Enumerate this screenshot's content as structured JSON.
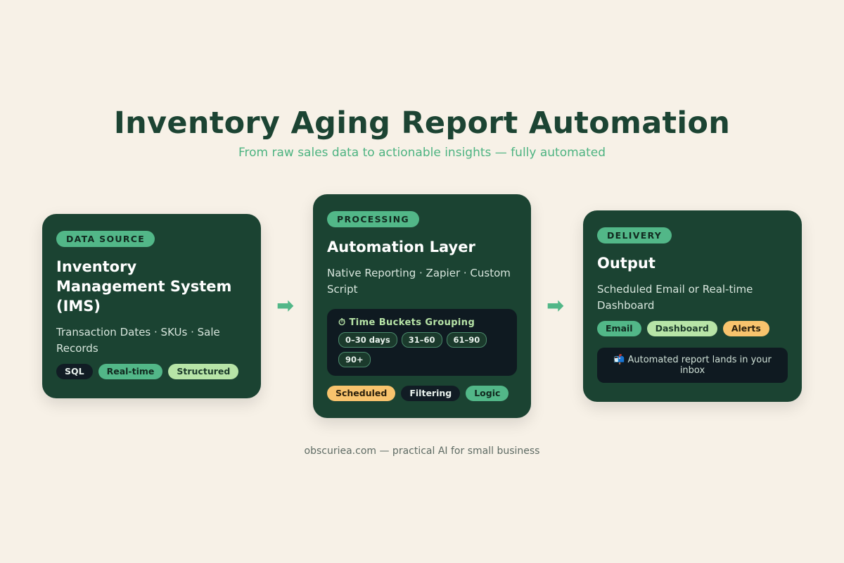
{
  "header": {
    "title": "Inventory Aging Report Automation",
    "subtitle": "From raw sales data to actionable insights — fully automated"
  },
  "cards": [
    {
      "badge": "DATA SOURCE",
      "title": "Inventory Management System (IMS)",
      "description": "Transaction Dates · SKUs · Sale Records",
      "tags": [
        "SQL",
        "Real-time",
        "Structured"
      ]
    },
    {
      "badge": "PROCESSING",
      "title": "Automation Layer",
      "description": "Native Reporting · Zapier · Custom Script",
      "bucket_box": {
        "icon": "stopwatch-icon",
        "icon_glyph": "⏱",
        "title": "Time Buckets Grouping",
        "buckets": [
          "0–30 days",
          "31–60",
          "61–90",
          "90+"
        ]
      },
      "tags": [
        "Scheduled",
        "Filtering",
        "Logic"
      ]
    },
    {
      "badge": "DELIVERY",
      "title": "Output",
      "description": "Scheduled Email or Real-time Dashboard",
      "tags": [
        "Email",
        "Dashboard",
        "Alerts"
      ],
      "note": {
        "icon": "mailbox-icon",
        "icon_glyph": "📬",
        "text": "Automated report lands in your inbox"
      }
    }
  ],
  "arrows": {
    "icon": "right-arrow-icon",
    "glyph": "➡"
  },
  "colors": {
    "background": "#f7f1e7",
    "card": "#1b4332",
    "accent_green": "#52b788",
    "lime": "#b7e4a7",
    "orange": "#f8c36d",
    "dark": "#111c24"
  },
  "footer": {
    "text": "obscuriea.com — practical AI for small business"
  }
}
